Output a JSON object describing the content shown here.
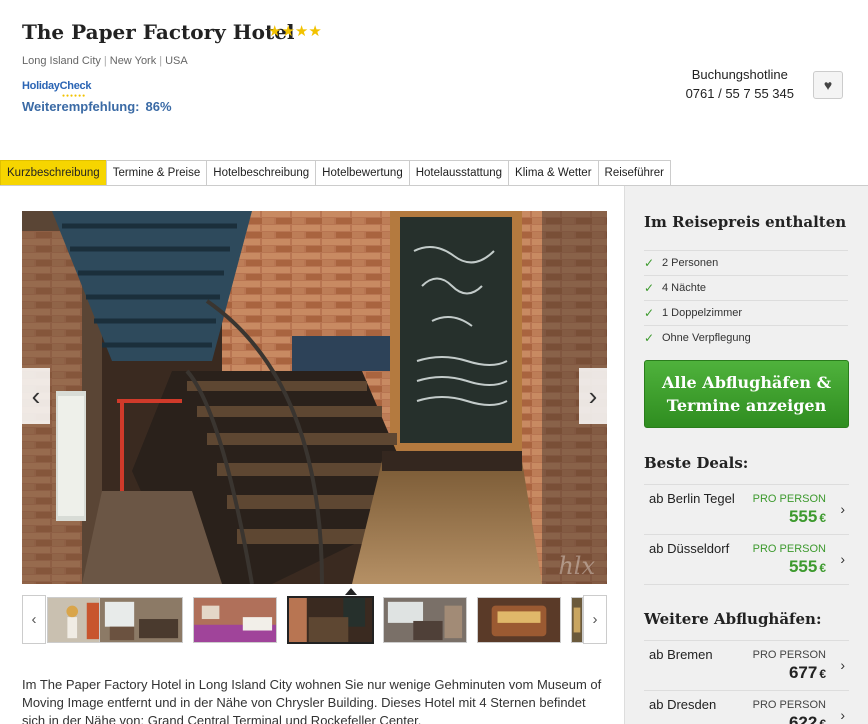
{
  "header": {
    "hotel_name": "The Paper Factory Hotel",
    "stars": "★★★★",
    "location": {
      "city": "Long Island City",
      "region": "New York",
      "country": "USA"
    },
    "holidaycheck": {
      "logo_text": "HolidayCheck",
      "label": "Weiterempfehlung:",
      "value": "86%"
    },
    "hotline": {
      "label": "Buchungshotline",
      "number": "0761 / 55 7 55 345"
    },
    "favorite_icon": "heart-icon"
  },
  "tabs": [
    {
      "label": "Kurzbeschreibung",
      "active": true
    },
    {
      "label": "Termine & Preise"
    },
    {
      "label": "Hotelbeschreibung"
    },
    {
      "label": "Hotelbewertung"
    },
    {
      "label": "Hotelausstattung"
    },
    {
      "label": "Klima & Wetter"
    },
    {
      "label": "Reiseführer"
    }
  ],
  "gallery": {
    "watermark": "hlx",
    "prev_icon": "chevron-left-icon",
    "next_icon": "chevron-right-icon"
  },
  "sidebar": {
    "included_heading": "Im Reisepreis enthalten",
    "included": [
      "2 Personen",
      "4 Nächte",
      "1 Doppelzimmer",
      "Ohne Verpflegung"
    ],
    "cta_line1": "Alle Abflughäfen &",
    "cta_line2": "Termine anzeigen",
    "best_deals_heading": "Beste Deals:",
    "best_deals": [
      {
        "city": "ab Berlin Tegel",
        "per": "PRO PERSON",
        "price": "555",
        "currency": "€"
      },
      {
        "city": "ab Düsseldorf",
        "per": "PRO PERSON",
        "price": "555",
        "currency": "€"
      }
    ],
    "more_heading": "Weitere Abflughäfen:",
    "more_airports": [
      {
        "city": "ab Bremen",
        "per": "PRO PERSON",
        "price": "677",
        "currency": "€"
      },
      {
        "city": "ab Dresden",
        "per": "PRO PERSON",
        "price": "622",
        "currency": "€"
      }
    ]
  },
  "description": "Im The Paper Factory Hotel in Long Island City wohnen Sie nur wenige Gehminuten vom Museum of Moving Image entfernt und in der Nähe von Chrysler Building. Dieses Hotel mit 4 Sternen befindet sich in der Nähe von: Grand Central Terminal und Rockefeller Center."
}
